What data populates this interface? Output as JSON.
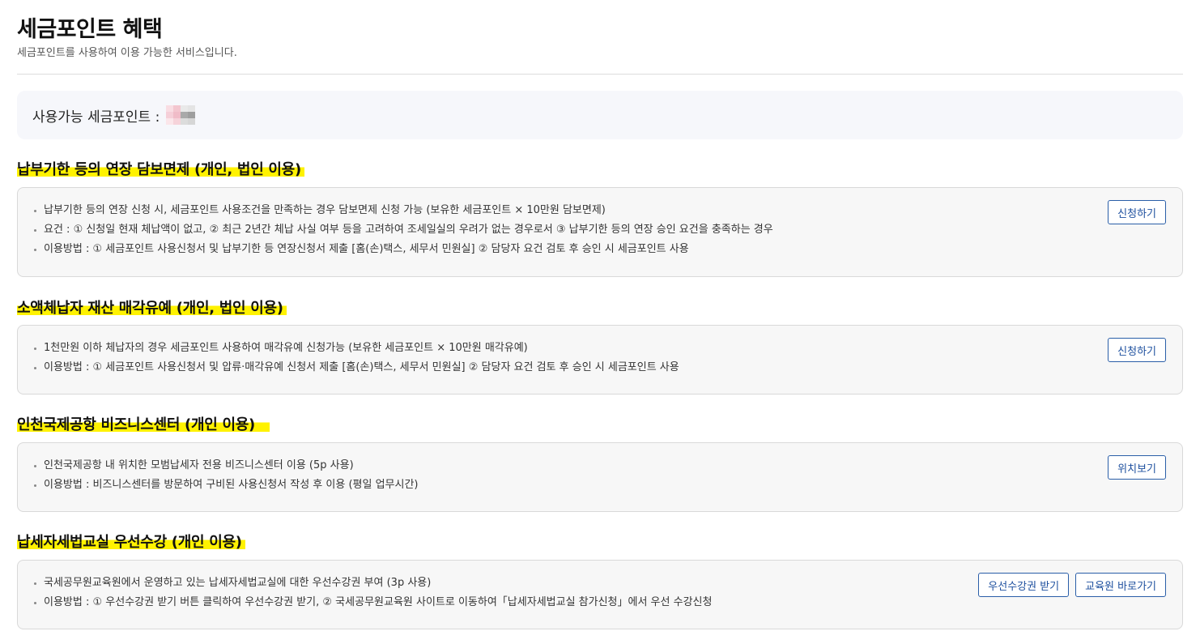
{
  "header": {
    "title": "세금포인트 혜택",
    "subtitle": "세금포인트를 사용하여 이용 가능한 서비스입니다."
  },
  "points": {
    "label": "사용가능 세금포인트 :"
  },
  "sections": [
    {
      "title": "납부기한 등의 연장 담보면제 (개인, 법인 이용)",
      "items": [
        "납부기한 등의 연장 신청 시, 세금포인트 사용조건을 만족하는 경우 담보면제 신청 가능 (보유한 세금포인트 × 10만원 담보면제)",
        "요건 : ① 신청일 현재 체납액이 없고, ② 최근 2년간 체납 사실 여부 등을 고려하여 조세일실의 우려가 없는 경우로서 ③ 납부기한 등의 연장 승인 요건을 충족하는 경우",
        "이용방법 : ① 세금포인트 사용신청서 및 납부기한 등 연장신청서 제출 [홈(손)택스, 세무서 민원실] ② 담당자 요건 검토 후 승인 시 세금포인트 사용"
      ],
      "buttons": [
        "신청하기"
      ]
    },
    {
      "title": "소액체납자 재산 매각유예 (개인, 법인 이용)",
      "items": [
        "1천만원 이하 체납자의 경우 세금포인트 사용하여 매각유예 신청가능 (보유한 세금포인트 × 10만원 매각유예)",
        "이용방법 : ① 세금포인트 사용신청서 및 압류·매각유예 신청서 제출 [홈(손)택스, 세무서 민원실] ② 담당자 요건 검토 후 승인 시 세금포인트 사용"
      ],
      "buttons": [
        "신청하기"
      ]
    },
    {
      "title": "인천국제공항 비즈니스센터 (개인 이용)",
      "items": [
        "인천국제공항 내 위치한 모범납세자 전용 비즈니스센터 이용 (5p 사용)",
        "이용방법 : 비즈니스센터를 방문하여 구비된 사용신청서 작성 후 이용 (평일 업무시간)"
      ],
      "buttons": [
        "위치보기"
      ]
    },
    {
      "title": "납세자세법교실 우선수강 (개인 이용)",
      "items": [
        "국세공무원교육원에서 운영하고 있는 납세자세법교실에 대한 우선수강권 부여 (3p 사용)",
        "이용방법 : ① 우선수강권 받기 버튼 클릭하여 우선수강권 받기, ② 국세공무원교육원 사이트로 이동하여「납세자세법교실 참가신청」에서 우선 수강신청"
      ],
      "buttons": [
        "우선수강권 받기",
        "교육원 바로가기"
      ]
    }
  ],
  "colors": {
    "highlight": "#fff200",
    "button_border": "#2a5ea8",
    "button_text": "#1d4f9e",
    "card_bg": "#f7f7f7",
    "points_bg": "#f6f7fb"
  }
}
